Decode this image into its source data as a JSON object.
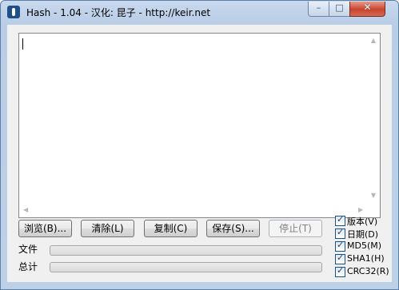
{
  "window": {
    "title": "Hash - 1.04 - 汉化: 昆子 - http://keir.net",
    "controls": {
      "minimize": "–",
      "maximize": "□",
      "close": "✕"
    }
  },
  "editor": {
    "value": "",
    "scroll_arrows": {
      "up": "▲",
      "down": "▼",
      "left": "◀",
      "right": "▶"
    }
  },
  "buttons": {
    "browse": "浏览(B)...",
    "clear": "清除(L)",
    "copy": "复制(C)",
    "save": "保存(S)...",
    "stop": "停止(T)"
  },
  "progress": {
    "file_label": "文件",
    "total_label": "总计",
    "file_value": 0,
    "total_value": 0
  },
  "options": [
    {
      "label": "版本(V)",
      "checked": true
    },
    {
      "label": "日期(D)",
      "checked": true
    },
    {
      "label": "MD5(M)",
      "checked": true
    },
    {
      "label": "SHA1(H)",
      "checked": true
    },
    {
      "label": "CRC32(R)",
      "checked": true
    }
  ],
  "check_mark": "✓"
}
